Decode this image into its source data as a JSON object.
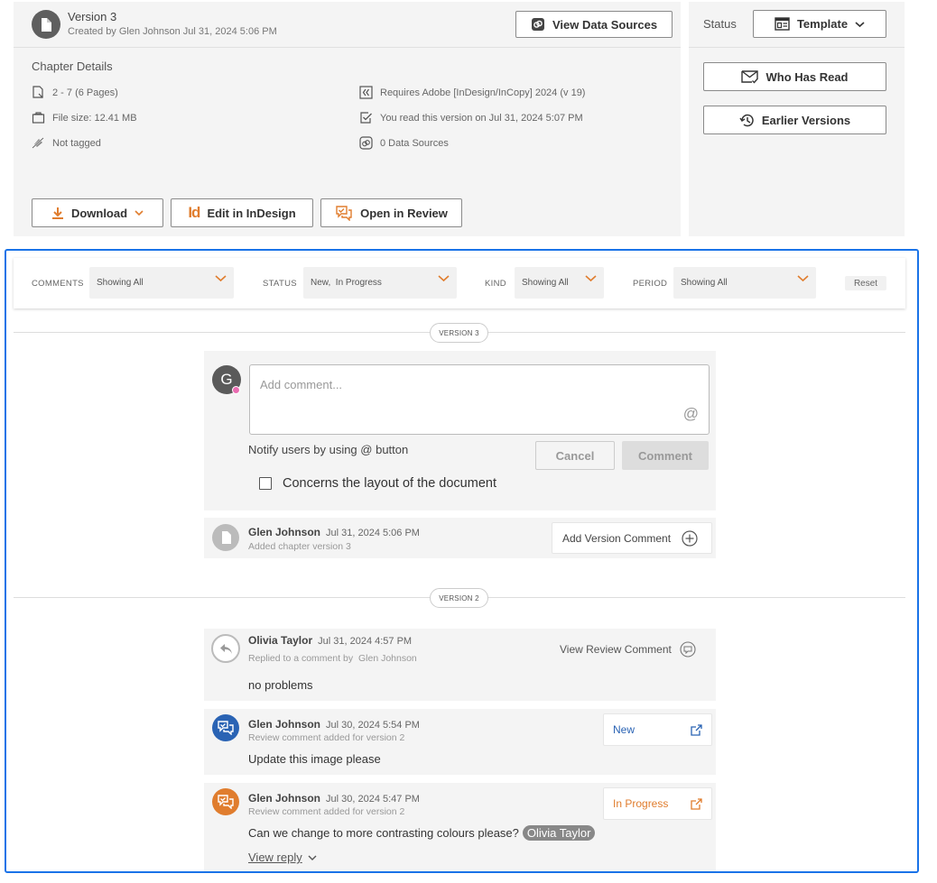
{
  "header": {
    "version_title": "Version 3",
    "created_by": "Created by Glen Johnson Jul 31, 2024 5:06 PM",
    "view_data_sources_label": "View Data Sources"
  },
  "chapter_details": {
    "title": "Chapter Details",
    "pages": "2 - 7 (6 Pages)",
    "file_size": "File size: 12.41 MB",
    "tagged": "Not tagged",
    "requires": "Requires Adobe [InDesign/InCopy] 2024 (v 19)",
    "read_status": "You read this version on Jul 31, 2024 5:07 PM",
    "data_sources": "0 Data Sources"
  },
  "actions": {
    "download_label": "Download",
    "edit_label": "Edit in InDesign",
    "review_label": "Open in Review",
    "edit_icon_text": "Id"
  },
  "status_panel": {
    "status_label": "Status",
    "status_value": "Template",
    "who_has_read_label": "Who Has Read",
    "earlier_versions_label": "Earlier Versions"
  },
  "filters": {
    "comments_label": "COMMENTS",
    "comments_value": "Showing All",
    "status_label": "STATUS",
    "status_value": "New,  In Progress",
    "kind_label": "KIND",
    "kind_value": "Showing All",
    "period_label": "PERIOD",
    "period_value": "Showing All",
    "reset_label": "Reset"
  },
  "version3": {
    "pill": "VERSION 3",
    "avatar_letter": "G",
    "comment_placeholder": "Add comment...",
    "at_symbol": "@",
    "notify_text": "Notify users by using @ button",
    "cancel_label": "Cancel",
    "comment_label": "Comment",
    "layout_checkbox_label": "Concerns the layout of the document",
    "event": {
      "author": "Glen Johnson",
      "time": "Jul 31, 2024 5:06 PM",
      "subtitle": "Added chapter version 3",
      "add_version_comment_label": "Add Version Comment"
    }
  },
  "version2": {
    "pill": "VERSION 2",
    "reply": {
      "author": "Olivia Taylor",
      "time": "Jul 31, 2024 4:57 PM",
      "subtitle": "Replied to a comment by  Glen Johnson",
      "text": "no problems",
      "view_review_comment_label": "View Review Comment"
    },
    "comment1": {
      "author": "Glen Johnson",
      "time": "Jul 30, 2024 5:54 PM",
      "subtitle": "Review comment added for version 2",
      "text": "Update this image please",
      "status": "New",
      "status_color": "#2a63b4",
      "icon_color": "#2a63b4"
    },
    "comment2": {
      "author": "Glen Johnson",
      "time": "Jul 30, 2024 5:47 PM",
      "subtitle": "Review comment added for version 2",
      "text": "Can we change to more contrasting colours please?",
      "mention": "Olivia Taylor",
      "status": "In Progress",
      "status_color": "#e07d2e",
      "icon_color": "#e07d2e",
      "view_reply_label": "View reply"
    }
  },
  "colors": {
    "accent_orange": "#e07d2e",
    "selection_blue": "#1a73e8"
  }
}
